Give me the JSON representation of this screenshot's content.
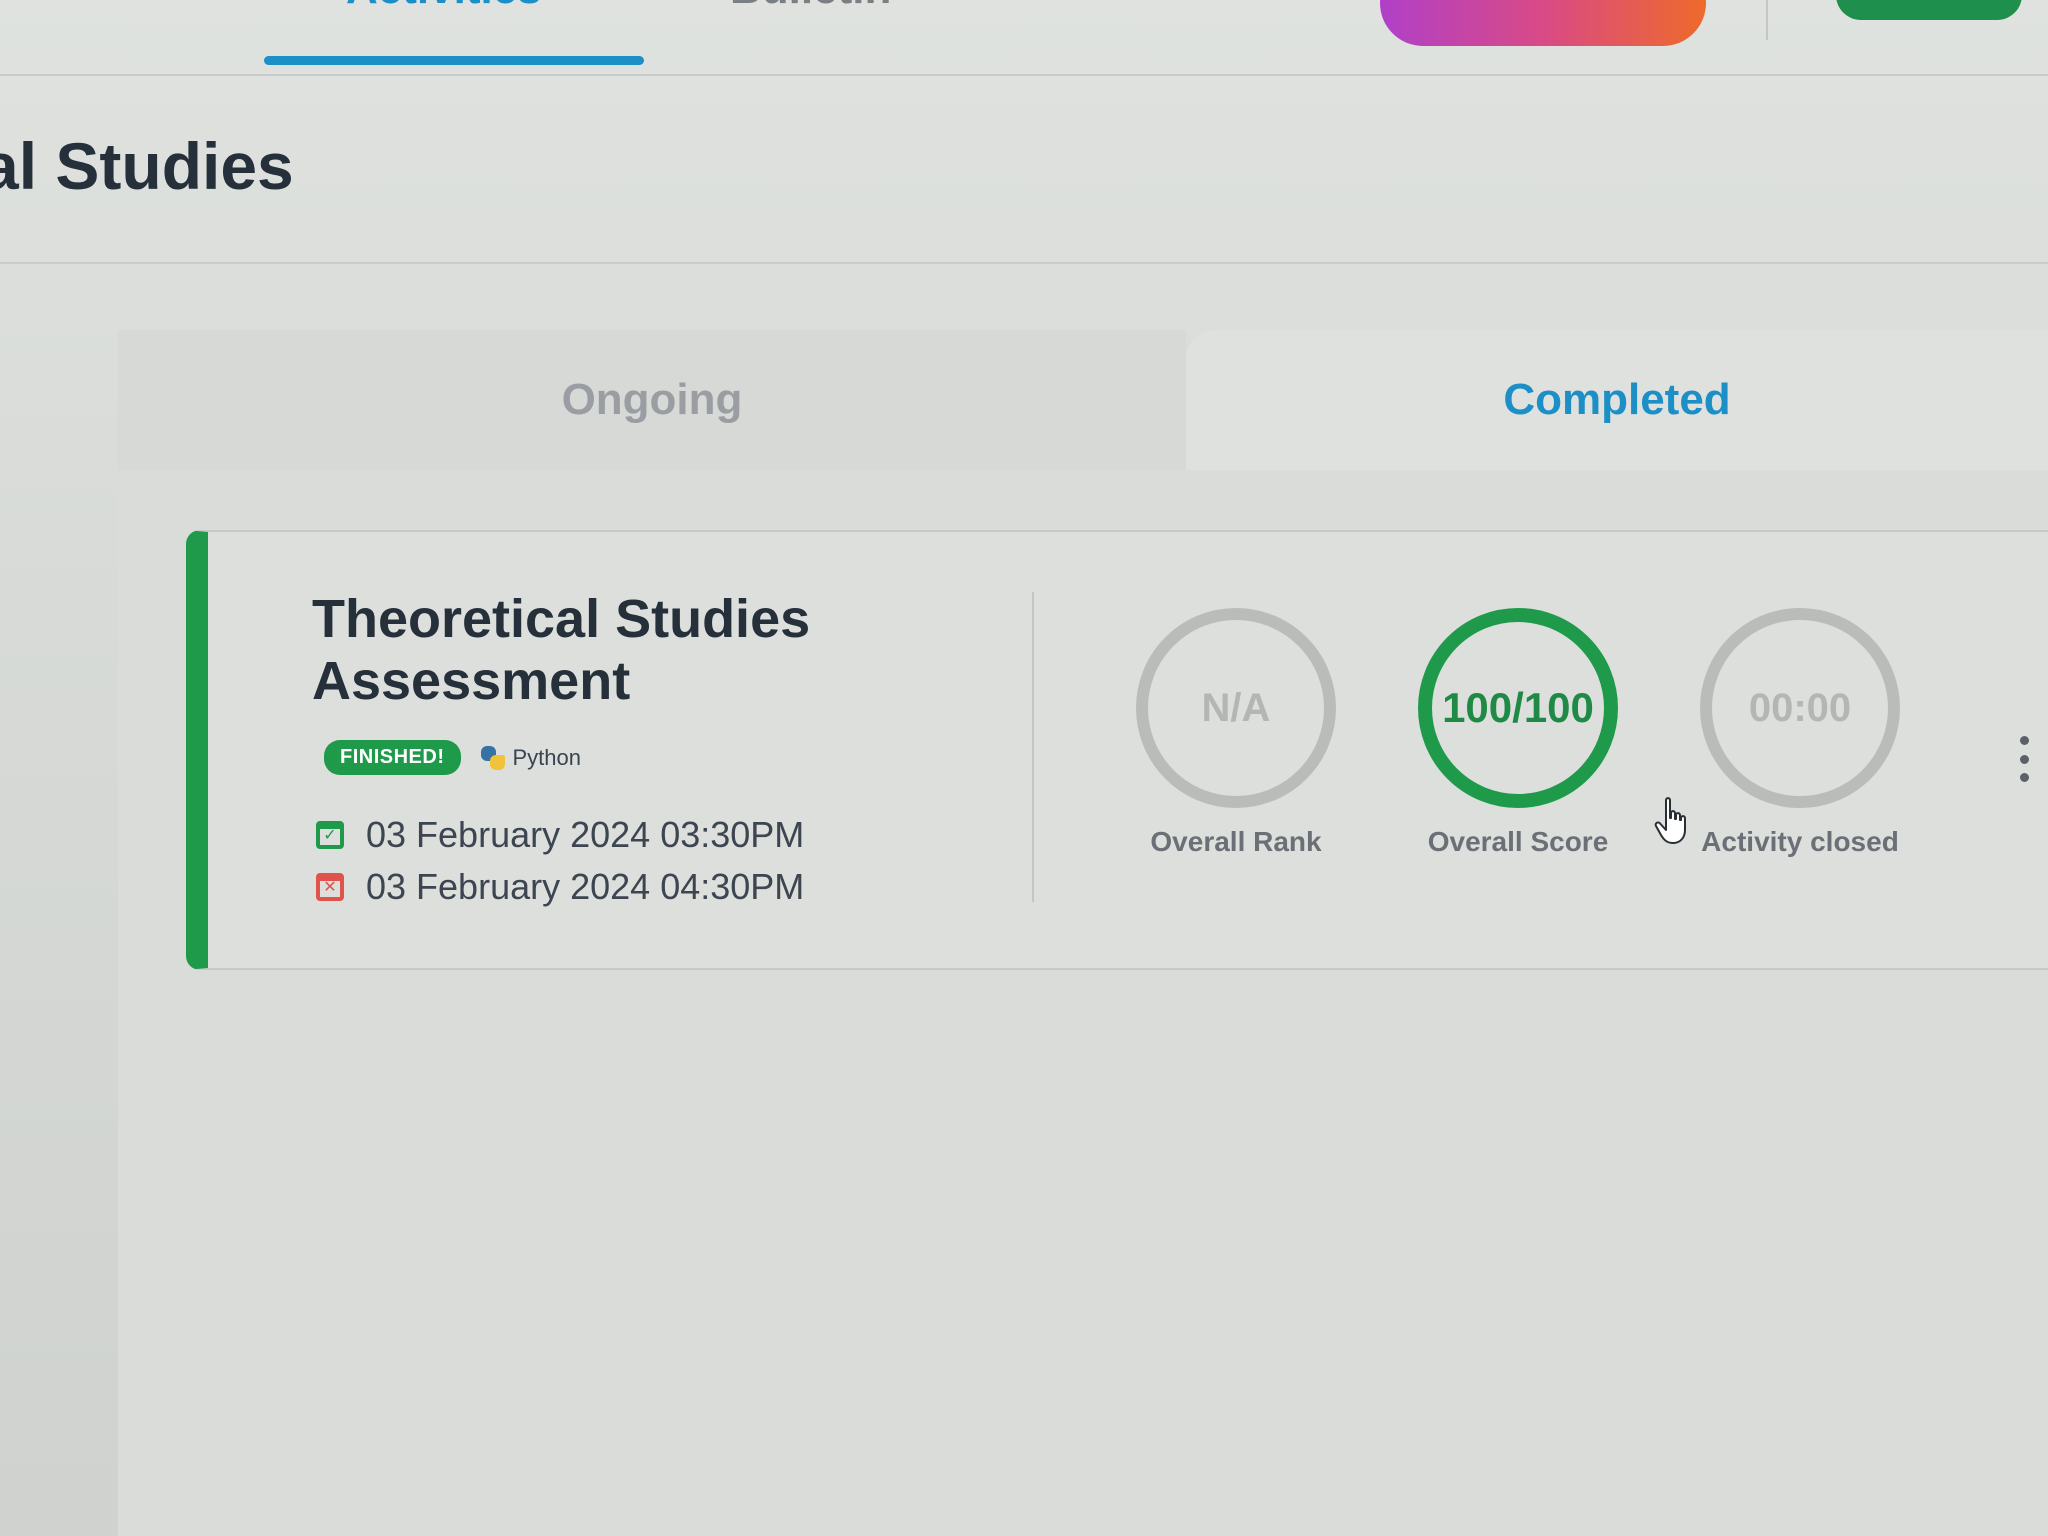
{
  "nav": {
    "tabs": [
      {
        "label": "Activities",
        "active": true
      },
      {
        "label": "Bulletin",
        "active": false
      }
    ]
  },
  "page": {
    "title": "al Studies"
  },
  "status_tabs": [
    {
      "label": "Ongoing",
      "active": false
    },
    {
      "label": "Completed",
      "active": true
    }
  ],
  "activity": {
    "title": "Theoretical Studies Assessment",
    "status_badge": "FINISHED!",
    "language": "Python",
    "language_icon": "python-icon",
    "start_date": "03 February 2024 03:30PM",
    "start_icon": "calendar-check-icon",
    "end_date": "03 February 2024 04:30PM",
    "end_icon": "calendar-x-icon",
    "stats": [
      {
        "value": "N/A",
        "label": "Overall Rank"
      },
      {
        "value": "100/100",
        "label": "Overall Score"
      },
      {
        "value": "00:00",
        "label": "Activity closed"
      }
    ],
    "accent_color": "#1f9a4b"
  },
  "colors": {
    "primary_blue": "#1d8fc7",
    "success_green": "#1f9a4b",
    "danger_red": "#e0534a"
  }
}
